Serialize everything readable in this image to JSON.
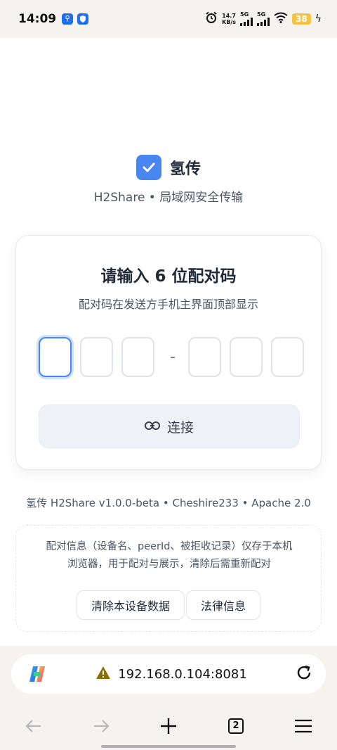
{
  "status": {
    "time": "14:09",
    "speed_value": "14.7",
    "speed_unit": "KB/s",
    "net1": "5G",
    "net2": "5G",
    "battery": "38"
  },
  "app": {
    "name": "氢传",
    "subtitle": "H2Share • 局域网安全传输"
  },
  "card": {
    "title": "请输入 6 位配对码",
    "subtitle": "配对码在发送方手机主界面顶部显示",
    "code": [
      "",
      "",
      "",
      "",
      "",
      ""
    ],
    "separator": "-",
    "connect_label": "连接"
  },
  "footer": {
    "version_line": "氢传 H2Share v1.0.0-beta  •  Cheshire233  •  Apache 2.0"
  },
  "info": {
    "text_line1": "配对信息（设备名、peerId、被拒收记录）仅存于本机",
    "text_line2": "浏览器，用于配对与展示，清除后需重新配对",
    "clear_label": "清除本设备数据",
    "legal_label": "法律信息"
  },
  "browser": {
    "url": "192.168.0.104:8081",
    "tab_count": "2"
  },
  "colors": {
    "accent": "#4a86f0",
    "button_bg": "#eef2f8",
    "warning": "#8a6d00"
  },
  "icons": [
    "usb-icon",
    "shield-icon",
    "alarm-icon",
    "wifi-icon",
    "check-icon",
    "link-icon",
    "warning-icon",
    "reload-icon",
    "back-icon",
    "forward-icon",
    "plus-icon",
    "tabs-icon",
    "menu-icon",
    "copilot-icon"
  ]
}
